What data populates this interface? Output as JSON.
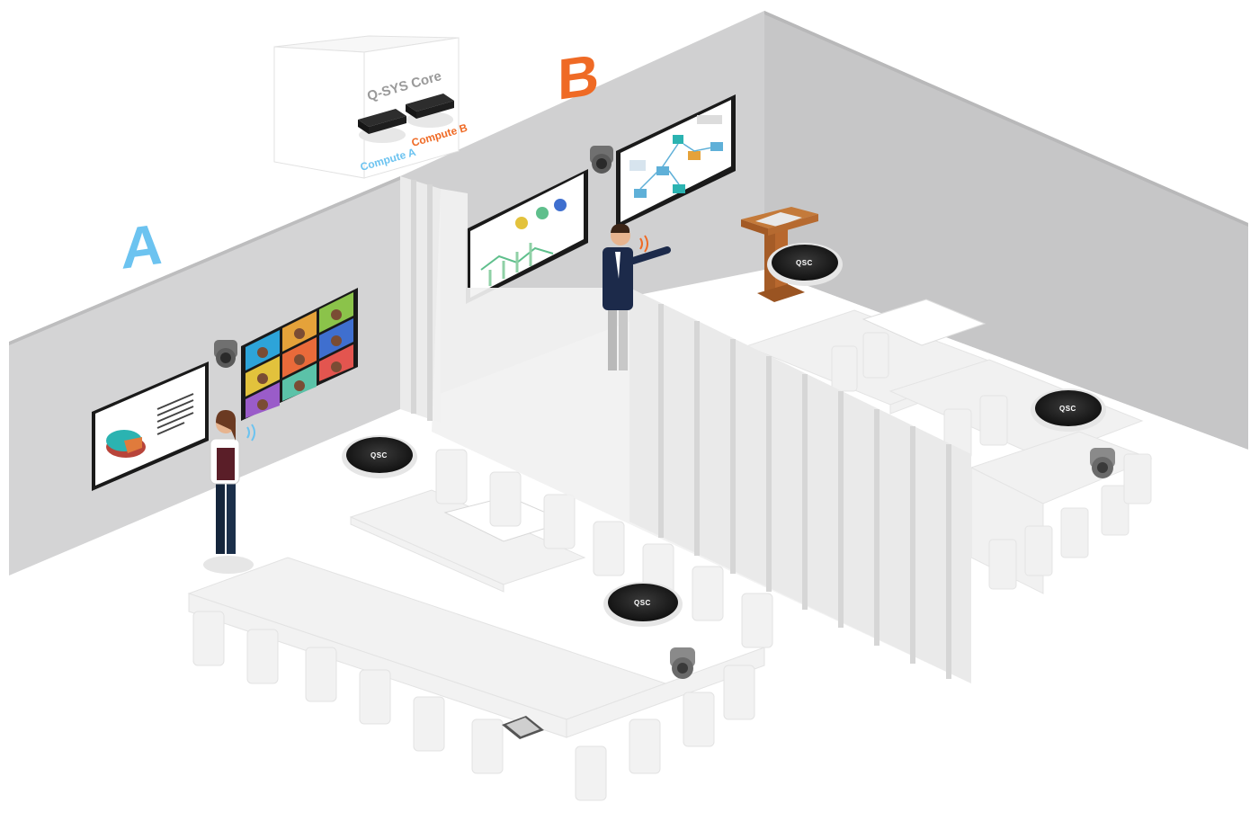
{
  "rooms": {
    "a_label": "A",
    "b_label": "B"
  },
  "core": {
    "title": "Q-SYS Core",
    "compute_a": "Compute A",
    "compute_b": "Compute B"
  },
  "devices": {
    "ceiling_mic_brand": "QSC"
  },
  "colors": {
    "room_a": "#6cc3f0",
    "room_b": "#ef6a25",
    "wall": "#d3d3d4",
    "wall_dark": "#c4c4c5",
    "floor": "#ffffff",
    "furniture": "#f2f2f2",
    "device_dark": "#1e1e1e",
    "podium": "#b2652e"
  },
  "icons": [
    "ptz-camera-icon",
    "ceiling-mic-icon",
    "touch-panel-icon",
    "sound-wave-icon"
  ]
}
